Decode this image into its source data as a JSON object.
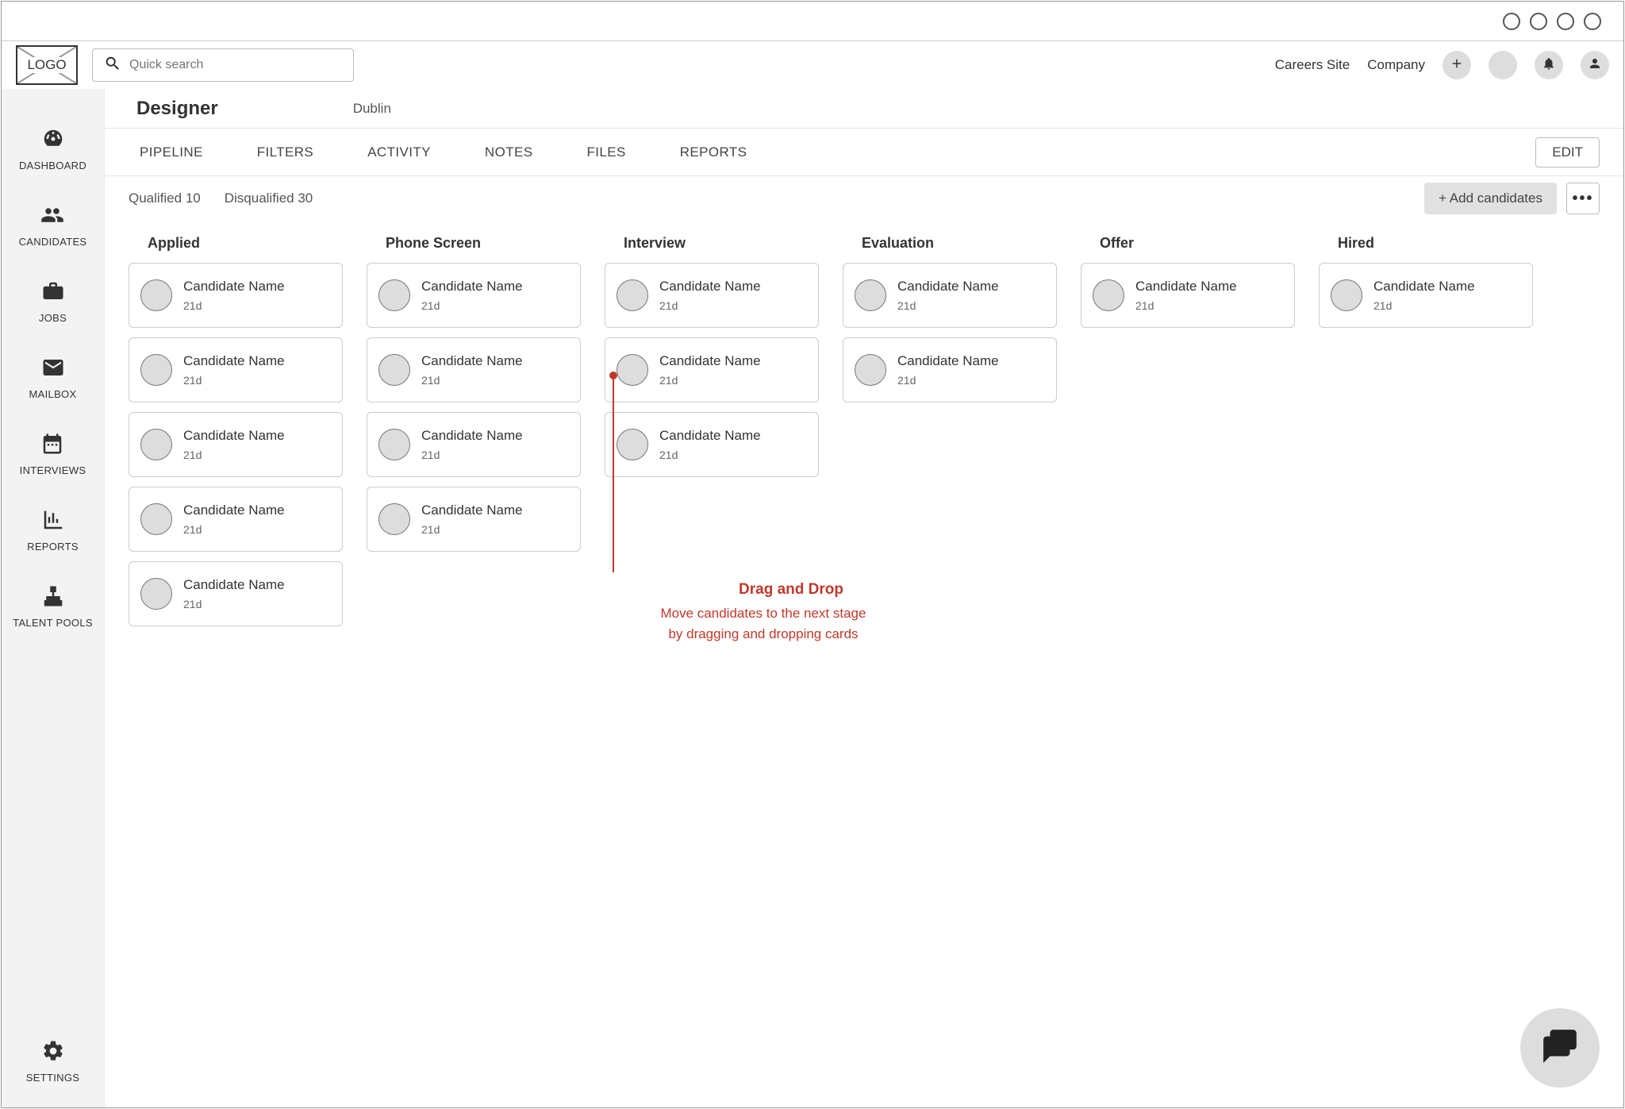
{
  "logo": "LOGO",
  "search": {
    "placeholder": "Quick search"
  },
  "topbar": {
    "careers": "Careers Site",
    "company": "Company"
  },
  "sidebar": {
    "items": [
      {
        "label": "DASHBOARD"
      },
      {
        "label": "CANDIDATES"
      },
      {
        "label": "JOBS"
      },
      {
        "label": "MAILBOX"
      },
      {
        "label": "INTERVIEWS"
      },
      {
        "label": "REPORTS"
      },
      {
        "label": "TALENT POOLS"
      }
    ],
    "settings": "SETTINGS"
  },
  "job": {
    "title": "Designer",
    "location": "Dublin"
  },
  "tabs": [
    {
      "label": "PIPELINE"
    },
    {
      "label": "FILTERS"
    },
    {
      "label": "ACTIVITY"
    },
    {
      "label": "NOTES"
    },
    {
      "label": "FILES"
    },
    {
      "label": "REPORTS"
    }
  ],
  "edit_label": "EDIT",
  "filters": {
    "qualified": "Qualified 10",
    "disqualified": "Disqualified 30"
  },
  "add_candidates": "+ Add candidates",
  "kebab": "•••",
  "stages": [
    {
      "name": "Applied",
      "count": 5
    },
    {
      "name": "Phone Screen",
      "count": 4
    },
    {
      "name": "Interview",
      "count": 3
    },
    {
      "name": "Evaluation",
      "count": 2
    },
    {
      "name": "Offer",
      "count": 1
    },
    {
      "name": "Hired",
      "count": 1
    }
  ],
  "card_default": {
    "name": "Candidate Name",
    "age": "21d"
  },
  "annotation": {
    "title": "Drag and Drop",
    "line1": "Move candidates to the next stage",
    "line2": "by dragging and dropping cards"
  }
}
